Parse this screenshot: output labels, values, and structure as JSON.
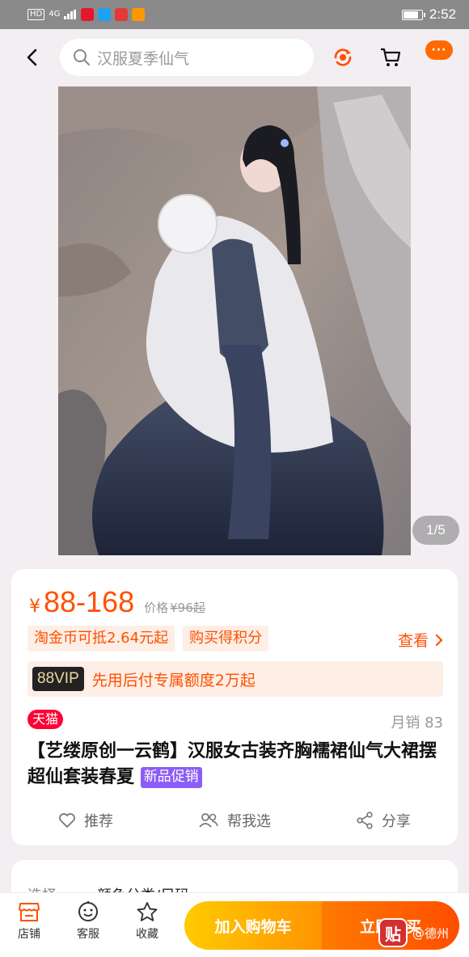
{
  "status_bar": {
    "hd": "HD",
    "signal": "4G",
    "time": "2:52",
    "battery_level": 0.8
  },
  "search": {
    "placeholder": "汉服夏季仙气"
  },
  "gallery": {
    "counter": "1/5"
  },
  "product": {
    "price_symbol": "¥",
    "price_range": "88-168",
    "orig_label": "价格",
    "orig_price": "¥96起",
    "tags": [
      "淘金币可抵2.64元起",
      "购买得积分"
    ],
    "see_more": "查看",
    "vip_badge": "88VIP",
    "vip_text": "先用后付专属额度2万起",
    "store_badge": "天猫",
    "monthly_sales": "月销 83",
    "title": "【艺缕原创一云鹤】汉服女古装齐胸襦裙仙气大裙摆超仙套装春夏",
    "new_badge": "新品促销",
    "actions": [
      "推荐",
      "帮我选",
      "分享"
    ]
  },
  "next_section": {
    "label": "选择",
    "value": "颜色分类/尺码"
  },
  "bottom_bar": {
    "items": [
      "店铺",
      "客服",
      "收藏"
    ],
    "add_to_cart": "加入购物车",
    "buy_now": "立即购买"
  },
  "watermark": {
    "logo": "贴",
    "text": "@德州"
  },
  "colors": {
    "accent": "#ff5000",
    "tmall": "#ff0036",
    "cart": "#ffb300",
    "buy": "#ff5500"
  }
}
